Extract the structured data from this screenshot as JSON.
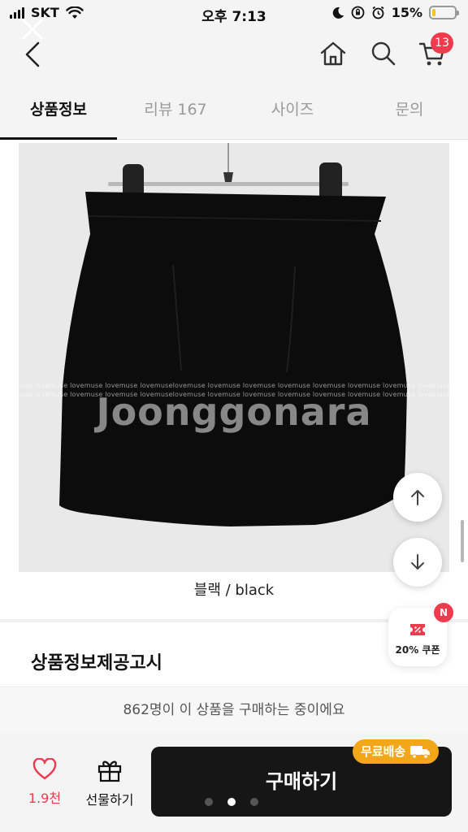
{
  "status_bar": {
    "carrier": "SKT",
    "time": "오후 7:13",
    "battery": "15%",
    "battery_level": 0.15
  },
  "header": {
    "cart_count": "13"
  },
  "tabs": [
    {
      "label": "상품정보",
      "active": true
    },
    {
      "label": "리뷰 167",
      "active": false
    },
    {
      "label": "사이즈",
      "active": false
    },
    {
      "label": "문의",
      "active": false
    }
  ],
  "product_image": {
    "watermark_small": "lovemuse lovemuse lovemuse lovemuse lovemuselovemuse lovemuse lovemuse lovemuse lovemuse lovemuse lovemuse lovemuse lovemuse lovemuse",
    "watermark_brand": "Joonggonara",
    "caption": "블랙 / black"
  },
  "section": {
    "title": "상품정보제공고시"
  },
  "coupon": {
    "label": "20% 쿠폰",
    "badge": "N"
  },
  "buying_notice": "862명이 이 상품을 구매하는 중이에요",
  "bottom": {
    "like_count": "1.9천",
    "gift_label": "선물하기",
    "buy_label": "구매하기",
    "free_shipping_label": "무료배송"
  },
  "colors": {
    "accent_red": "#ef3b4e",
    "shipping_orange": "#f2a71b",
    "buy_button": "#161616"
  }
}
